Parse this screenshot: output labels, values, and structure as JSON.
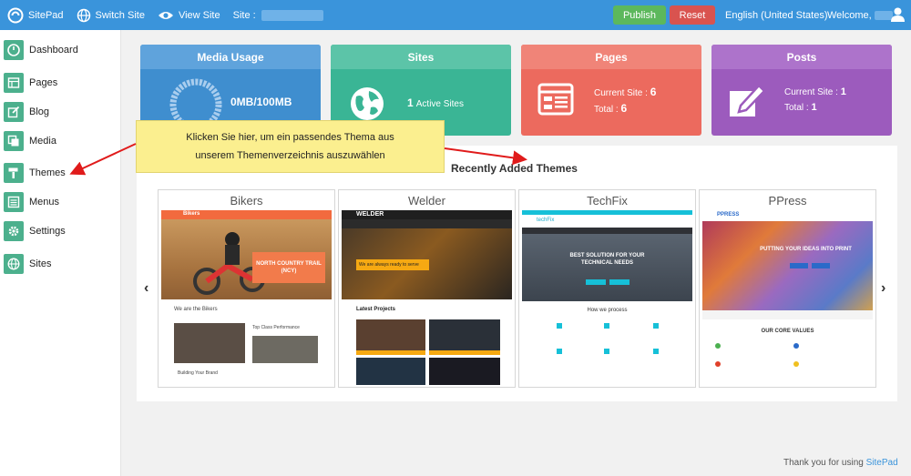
{
  "topbar": {
    "brand": "SitePad",
    "switch_site": "Switch Site",
    "view_site": "View Site",
    "site_label": "Site :",
    "publish": "Publish",
    "reset": "Reset",
    "language": "English (United States)",
    "welcome": "Welcome,"
  },
  "sidebar": {
    "items": [
      {
        "label": "Dashboard",
        "icon": "dashboard-icon"
      },
      {
        "label": "Pages",
        "icon": "pages-icon"
      },
      {
        "label": "Blog",
        "icon": "blog-icon"
      },
      {
        "label": "Media",
        "icon": "media-icon"
      },
      {
        "label": "Themes",
        "icon": "themes-icon"
      },
      {
        "label": "Menus",
        "icon": "menus-icon"
      },
      {
        "label": "Settings",
        "icon": "gear-icon"
      },
      {
        "label": "Sites",
        "icon": "globe-icon"
      }
    ]
  },
  "cards": {
    "media": {
      "title": "Media Usage",
      "value": "0MB/100MB"
    },
    "sites": {
      "title": "Sites",
      "count": "1",
      "label": "Active Sites"
    },
    "pages": {
      "title": "Pages",
      "current_label": "Current Site :",
      "current": "6",
      "total_label": "Total :",
      "total": "6"
    },
    "posts": {
      "title": "Posts",
      "current_label": "Current Site :",
      "current": "1",
      "total_label": "Total :",
      "total": "1"
    }
  },
  "themes": {
    "title": "Recently Added Themes",
    "items": [
      {
        "name": "Bikers"
      },
      {
        "name": "Welder"
      },
      {
        "name": "TechFix"
      },
      {
        "name": "PPress"
      }
    ]
  },
  "tooltip": {
    "line1": "Klicken Sie hier, um ein passendes Thema aus",
    "line2": "unserem Themenverzeichnis auszuwählen"
  },
  "footer": {
    "text": "Thank you for using",
    "link": "SitePad"
  },
  "preview_text": {
    "bikers": {
      "logo": "Bikers",
      "hero": "NORTH COUNTRY TRAIL (NCY)",
      "about": "We are the Bikers",
      "feature": "Top Class Performance",
      "build": "Building Your Brand"
    },
    "welder": {
      "logo": "WELDER",
      "hero": "We are always ready to serve",
      "projects": "Latest Projects"
    },
    "techfix": {
      "logo": "techFix",
      "hero1": "BEST SOLUTION FOR YOUR",
      "hero2": "TECHNICAL NEEDS",
      "process": "How we process"
    },
    "ppress": {
      "logo": "PPRESS",
      "hero": "PUTTING YOUR IDEAS INTO PRINT",
      "values": "OUR CORE VALUES"
    }
  },
  "colors": {
    "topbar": "#3a94db",
    "accent_green": "#4cb08d",
    "media": "#3f8ecf",
    "sites": "#3ab595",
    "pages": "#ec6a5e",
    "posts": "#9c5bbd",
    "tooltip": "#fbef8f",
    "arrow": "#e01b1b"
  }
}
